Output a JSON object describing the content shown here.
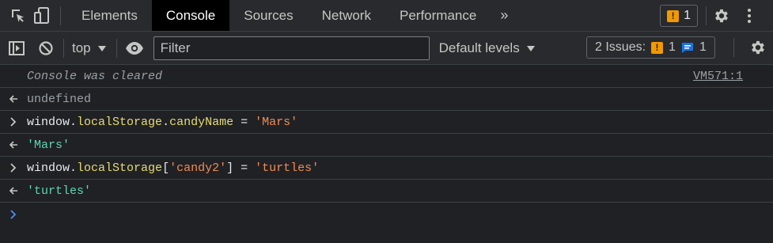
{
  "tabs": [
    "Elements",
    "Console",
    "Sources",
    "Network",
    "Performance"
  ],
  "top_warning_count": "1",
  "toolbar": {
    "context": "top",
    "filter_placeholder": "Filter",
    "levels": "Default levels",
    "issues_label": "2 Issues:",
    "issues_warn": "1",
    "issues_info": "1"
  },
  "console": {
    "cleared": "Console was cleared",
    "cleared_src": "VM571:1",
    "out1": "undefined",
    "cmd1": {
      "window": "window",
      "dot1": ".",
      "ls": "localStorage",
      "dot2": ".",
      "prop": "candyName",
      "eq": " = ",
      "val": "'Mars'"
    },
    "out2": "'Mars'",
    "cmd2": {
      "window": "window",
      "dot": ".",
      "ls": "localStorage",
      "br_open": "[",
      "key": "'candy2'",
      "br_close": "]",
      "eq": " = ",
      "val": "'turtles'"
    },
    "out3": "'turtles'"
  },
  "colors": {
    "background": "#202124",
    "panel": "#292a2d",
    "active_tab": "#000000",
    "property": "#e6db74",
    "string": "#f28b54",
    "result_string": "#5cd5b3",
    "prompt": "#4f8cff"
  },
  "icons": [
    "inspect-element-icon",
    "device-toolbar-icon",
    "more-tabs-icon",
    "warning-icon",
    "settings-gear-icon",
    "kebab-menu-icon",
    "sidebar-toggle-icon",
    "clear-console-icon",
    "dropdown-arrow-icon",
    "eye-icon",
    "info-message-icon",
    "result-arrow-icon",
    "input-chevron-icon",
    "prompt-chevron-icon"
  ]
}
